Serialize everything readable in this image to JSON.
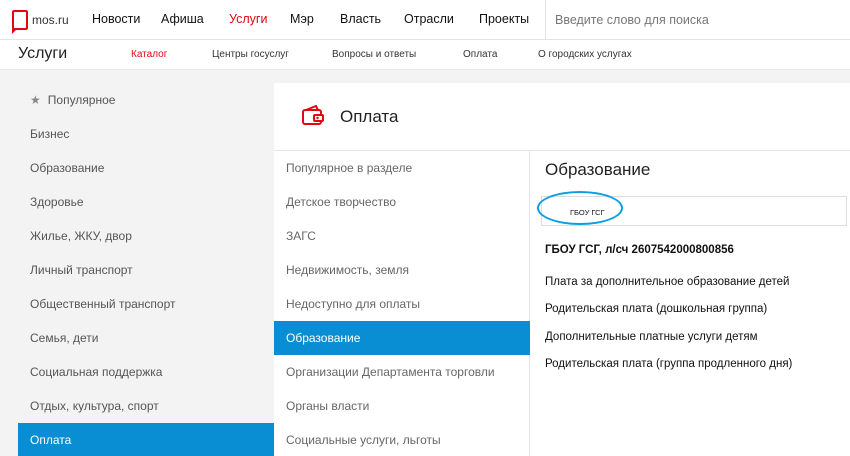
{
  "topnav": {
    "logo_text": "mos.ru",
    "items": [
      {
        "label": "Новости"
      },
      {
        "label": "Афиша"
      },
      {
        "label": "Услуги"
      },
      {
        "label": "Мэр"
      },
      {
        "label": "Власть"
      },
      {
        "label": "Отрасли"
      },
      {
        "label": "Проекты"
      }
    ],
    "active_item": "Услуги",
    "search_placeholder": "Введите слово для поиска"
  },
  "subnav": {
    "title": "Услуги",
    "items": [
      {
        "label": "Каталог"
      },
      {
        "label": "Центры госуслуг"
      },
      {
        "label": "Вопросы и ответы"
      },
      {
        "label": "Оплата"
      },
      {
        "label": "О городских услугах"
      }
    ],
    "active_item": "Каталог"
  },
  "categories": {
    "items": [
      {
        "label": "Популярное"
      },
      {
        "label": "Бизнес"
      },
      {
        "label": "Образование"
      },
      {
        "label": "Здоровье"
      },
      {
        "label": "Жилье, ЖКУ, двор"
      },
      {
        "label": "Личный транспорт"
      },
      {
        "label": "Общественный транспорт"
      },
      {
        "label": "Семья, дети"
      },
      {
        "label": "Социальная поддержка"
      },
      {
        "label": "Отдых, культура, спорт"
      },
      {
        "label": "Оплата"
      }
    ],
    "active_item": "Оплата"
  },
  "section": {
    "title": "Оплата",
    "icon": "wallet-icon"
  },
  "subcategories": {
    "items": [
      {
        "label": "Популярное в разделе"
      },
      {
        "label": "Детское творчество"
      },
      {
        "label": "ЗАГС"
      },
      {
        "label": "Недвижимость, земля"
      },
      {
        "label": "Недоступно для оплаты"
      },
      {
        "label": "Образование"
      },
      {
        "label": "Организации Департамента торговли"
      },
      {
        "label": "Органы власти"
      },
      {
        "label": "Социальные услуги, льготы"
      }
    ],
    "active_item": "Образование"
  },
  "detail": {
    "title": "Образование",
    "filter_value": "ГБОУ ГСГ",
    "org_title": "ГБОУ ГСГ, л/сч 2607542000800856",
    "services": [
      {
        "label": "Плата за дополнительное образование детей"
      },
      {
        "label": "Родительская плата (дошкольная группа)"
      },
      {
        "label": "Дополнительные платные услуги детям"
      },
      {
        "label": "Родительская плата (группа продленного дня)"
      }
    ]
  },
  "colors": {
    "accent_red": "#e30613",
    "active_blue": "#0a8ed3",
    "highlight_ellipse": "#0aa0e0"
  }
}
